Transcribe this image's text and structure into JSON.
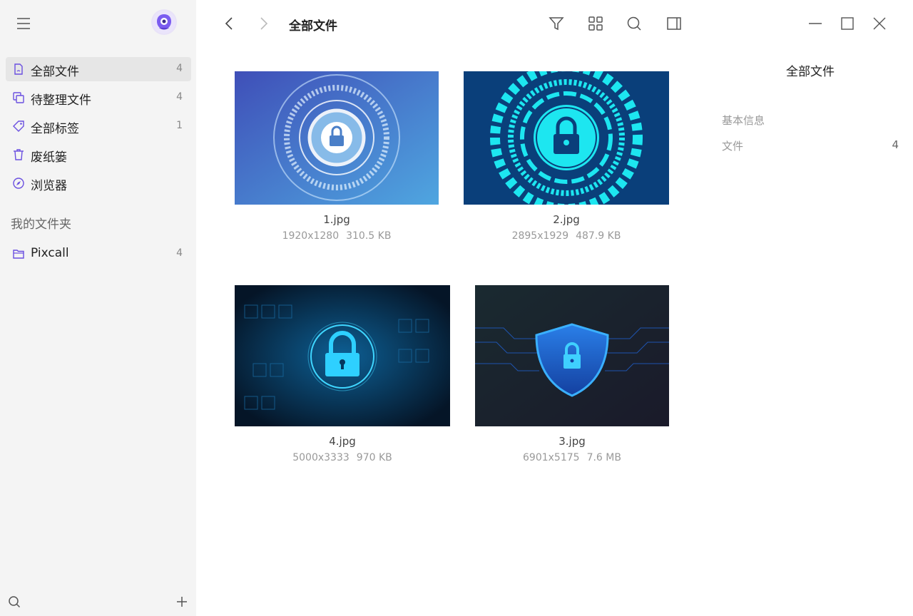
{
  "sidebar": {
    "items": [
      {
        "label": "全部文件",
        "count": "4",
        "icon": "document-icon"
      },
      {
        "label": "待整理文件",
        "count": "4",
        "icon": "copy-icon"
      },
      {
        "label": "全部标签",
        "count": "1",
        "icon": "tag-icon"
      },
      {
        "label": "废纸篓",
        "count": "",
        "icon": "trash-icon"
      },
      {
        "label": "浏览器",
        "count": "",
        "icon": "compass-icon"
      }
    ],
    "folders_title": "我的文件夹",
    "folders": [
      {
        "label": "Pixcall",
        "count": "4",
        "icon": "folder-icon"
      }
    ]
  },
  "toolbar": {
    "title": "全部文件"
  },
  "files": [
    {
      "name": "1.jpg",
      "dimensions": "1920x1280",
      "size": "310.5 KB"
    },
    {
      "name": "2.jpg",
      "dimensions": "2895x1929",
      "size": "487.9 KB"
    },
    {
      "name": "4.jpg",
      "dimensions": "5000x3333",
      "size": "970 KB"
    },
    {
      "name": "3.jpg",
      "dimensions": "6901x5175",
      "size": "7.6 MB"
    }
  ],
  "info_panel": {
    "title": "全部文件",
    "section": "基本信息",
    "key": "文件",
    "value": "4"
  },
  "colors": {
    "accent": "#6a4fe0",
    "sidebar_bg": "#f4f4f4"
  }
}
